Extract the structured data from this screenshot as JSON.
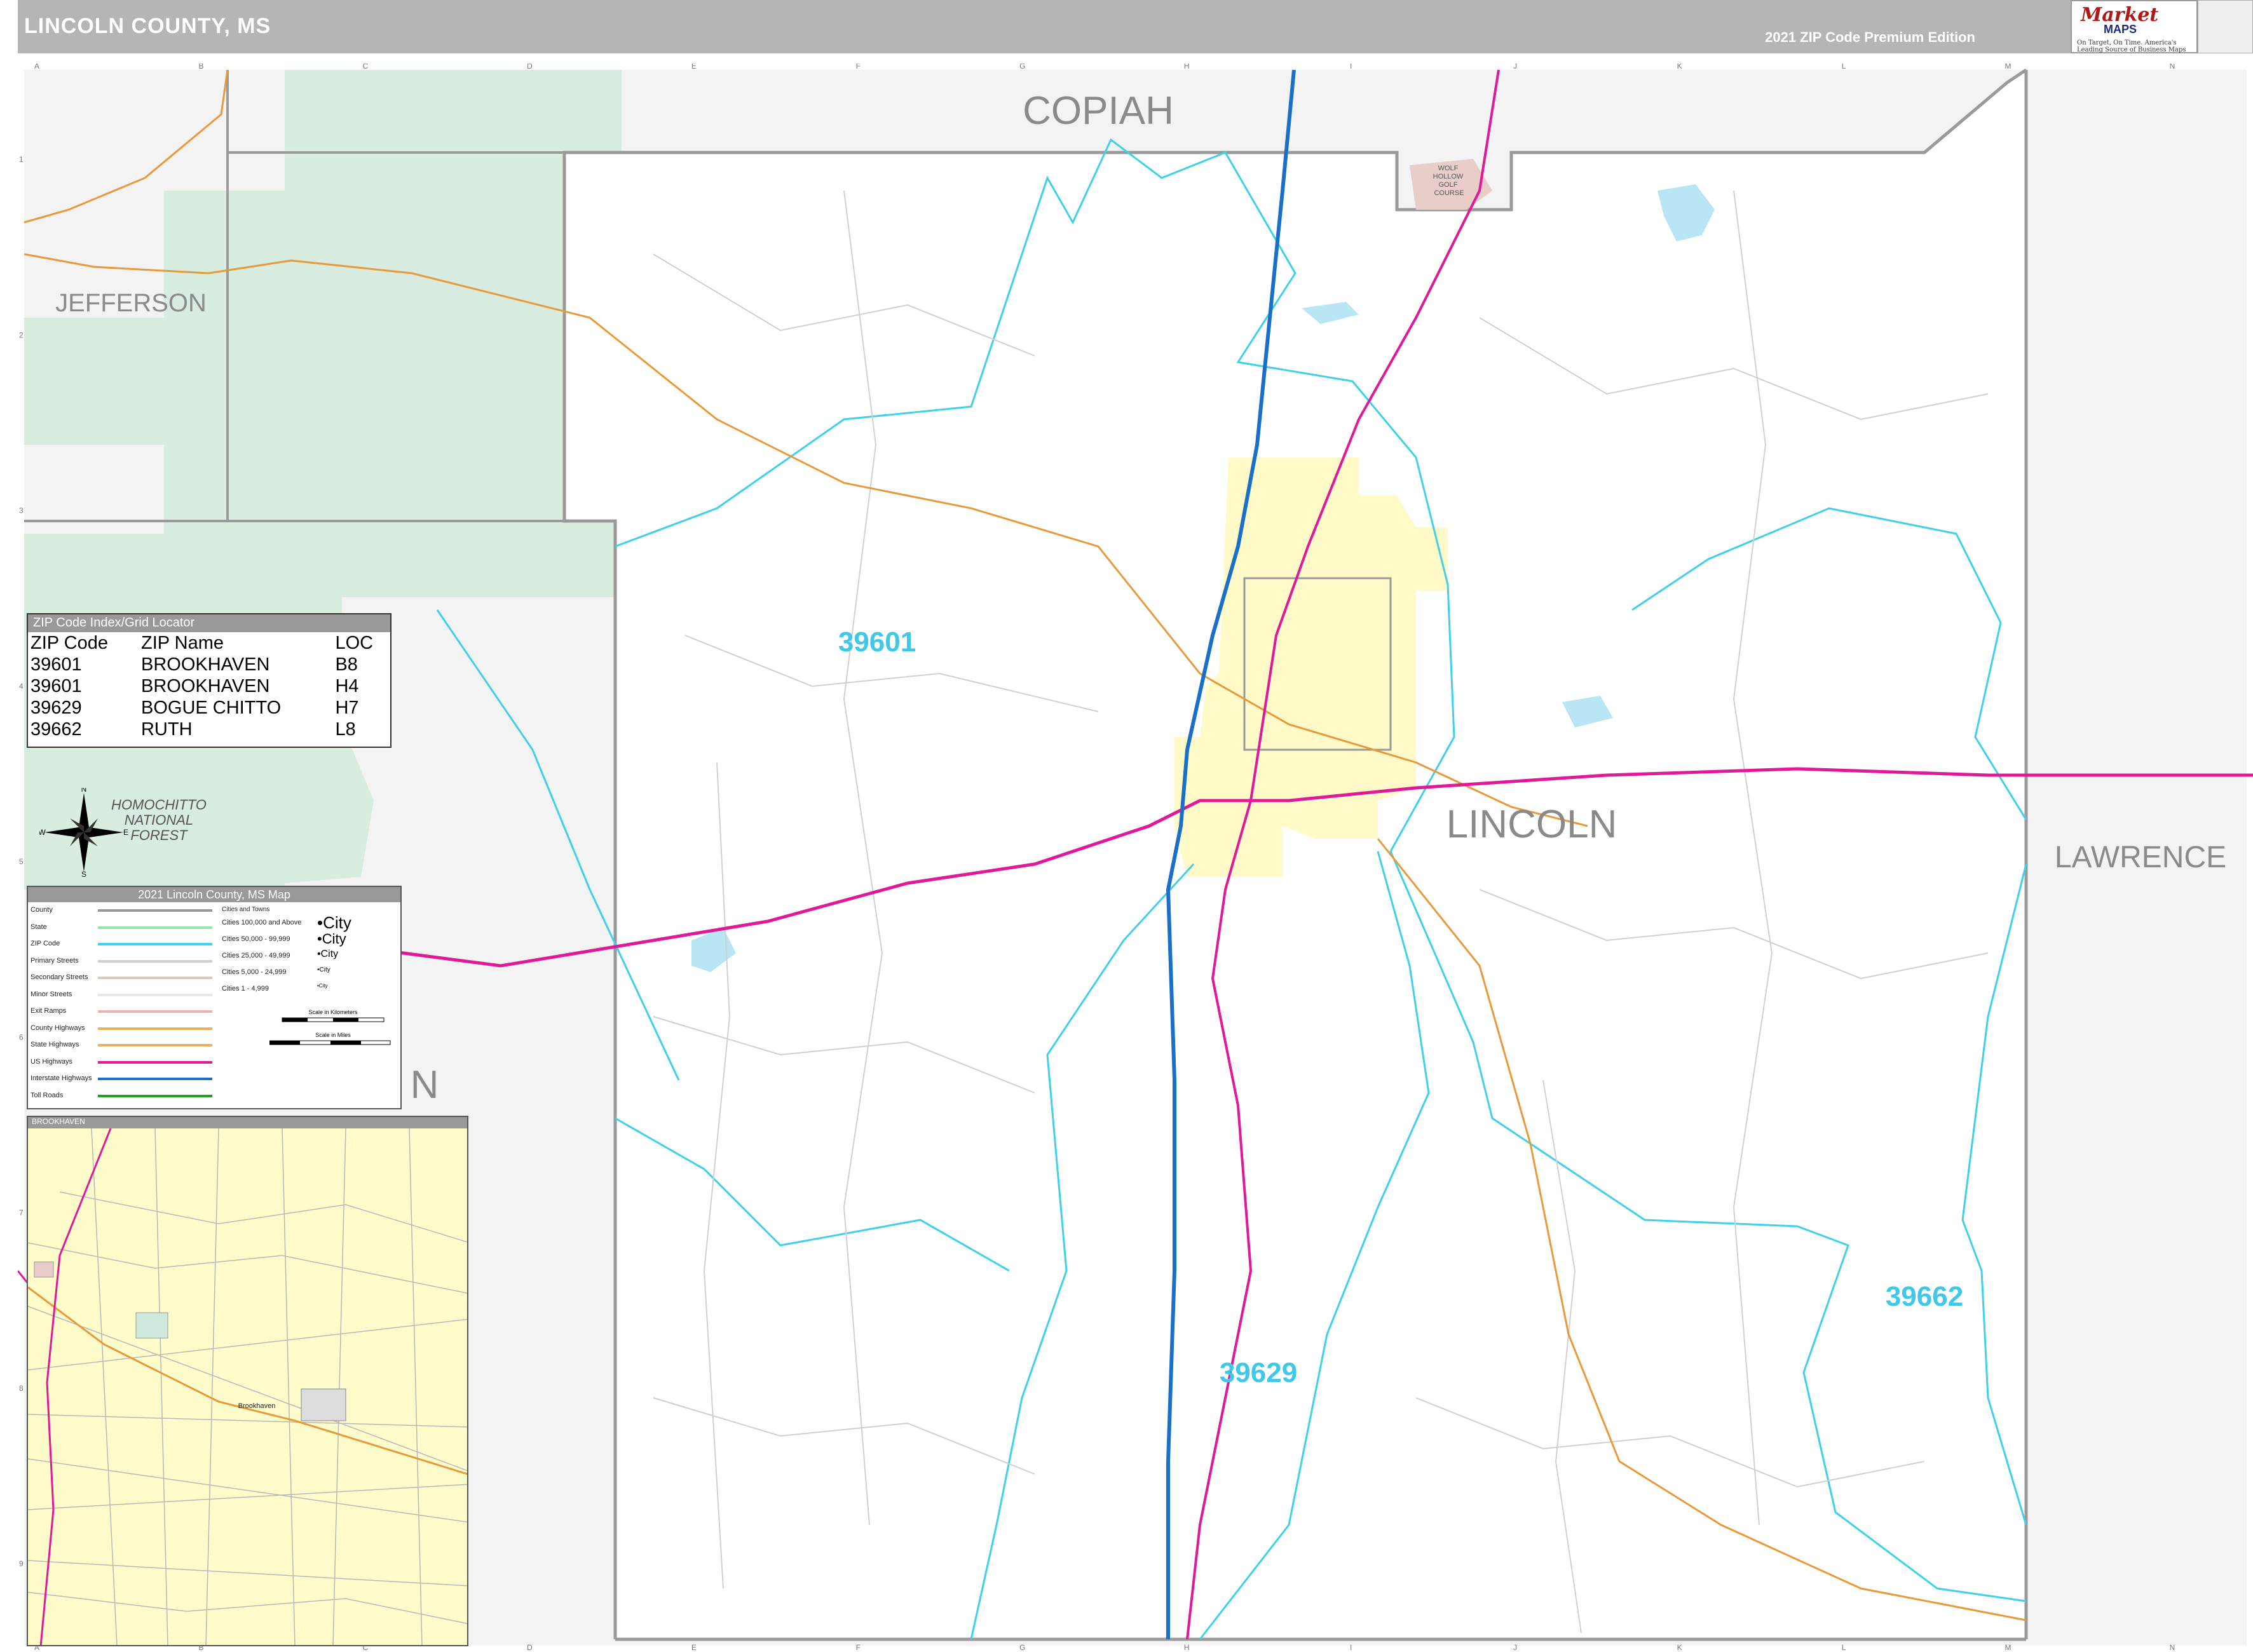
{
  "header": {
    "title": "LINCOLN COUNTY, MS",
    "edition": "2021 ZIP Code Premium Edition"
  },
  "logo": {
    "brand": "Market",
    "brand_sub": "MAPS",
    "tagline": "On Target, On Time. America's Leading Source of Business Maps"
  },
  "grid": {
    "columns": [
      "A",
      "B",
      "C",
      "D",
      "E",
      "F",
      "G",
      "H",
      "I",
      "J",
      "K",
      "L",
      "M",
      "N"
    ],
    "rows": [
      "1",
      "2",
      "3",
      "4",
      "5",
      "6",
      "7",
      "8",
      "9"
    ]
  },
  "county_labels": {
    "copiah": "COPIAH",
    "jefferson": "JEFFERSON",
    "lincoln": "LINCOLN",
    "lawrence": "LAWRENCE",
    "franklin_partial": "N"
  },
  "zip_labels": {
    "z39601": "39601",
    "z39629": "39629",
    "z39662": "39662"
  },
  "place_labels": {
    "golf": "WOLF\nHOLLOW\nGOLF\nCOURSE",
    "forest": "HOMOCHITTO\nNATIONAL\nFOREST"
  },
  "compass": {
    "n": "N",
    "s": "S",
    "e": "E",
    "w": "W"
  },
  "zip_index": {
    "title": "ZIP Code Index/Grid Locator",
    "headers": [
      "ZIP Code",
      "ZIP Name",
      "LOC"
    ],
    "rows": [
      [
        "39601",
        "BROOKHAVEN",
        "B8"
      ],
      [
        "39601",
        "BROOKHAVEN",
        "H4"
      ],
      [
        "39629",
        "BOGUE CHITTO",
        "H7"
      ],
      [
        "39662",
        "RUTH",
        "L8"
      ]
    ]
  },
  "legend": {
    "title": "2021 Lincoln County, MS Map",
    "items": [
      "County",
      "State",
      "ZIP Code",
      "Primary Streets",
      "Secondary Streets",
      "Minor Streets",
      "Exit Ramps",
      "County Highways",
      "State Highways",
      "US Highways",
      "Interstate Highways",
      "Toll Roads"
    ],
    "cities_title": "Cities and Towns",
    "cities": [
      "Cities 100,000 and Above",
      "Cities 50,000 - 99,999",
      "Cities 25,000 - 49,999",
      "Cities 5,000 - 24,999",
      "Cities 1 - 4,999"
    ],
    "city_samples": [
      "City",
      "City",
      "City",
      "City",
      "City"
    ],
    "scale_km": "Scale in Kilometers",
    "scale_mi": "Scale in Miles"
  },
  "inset": {
    "title": "BROOKHAVEN",
    "city": "Brookhaven"
  },
  "colors": {
    "county_line": "#9a9a9a",
    "zip_line": "#3fd0ea",
    "us_highway": "#e0189a",
    "interstate": "#1a70c8",
    "state_highway": "#e89a3a",
    "forest": "#d8ecdf",
    "city_area": "#fffac8",
    "outside": "#f3f3f3"
  }
}
